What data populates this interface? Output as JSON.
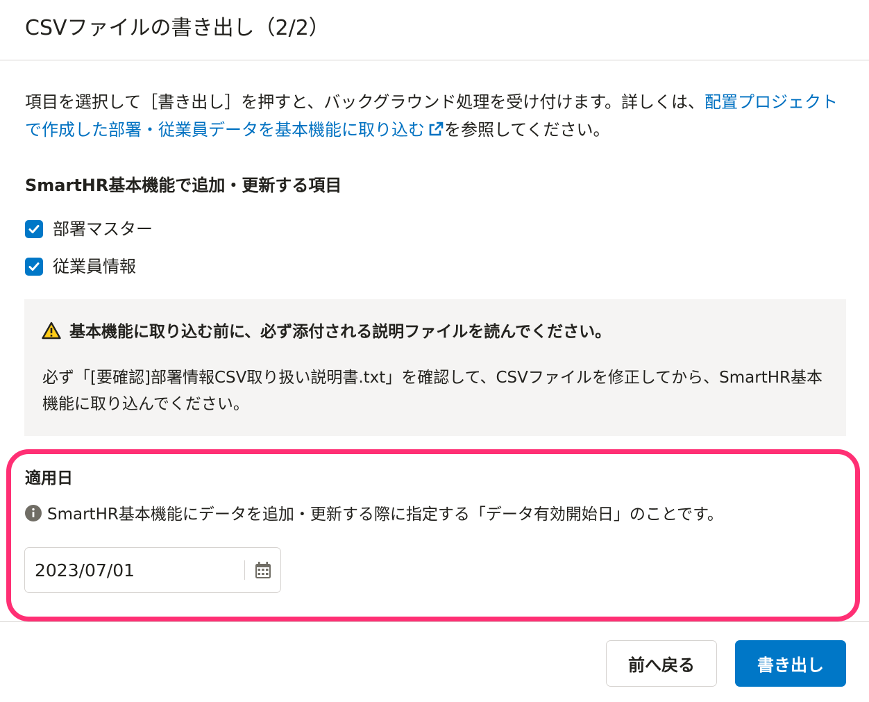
{
  "dialog": {
    "title": "CSVファイルの書き出し（2/2）"
  },
  "description": {
    "prefix": "項目を選択して［書き出し］を押すと、バックグラウンド処理を受け付けます。詳しくは、",
    "link_text": "配置プロジェクトで作成した部署・従業員データを基本機能に取り込む",
    "suffix": "を参照してください。"
  },
  "items_section": {
    "title": "SmartHR基本機能で追加・更新する項目",
    "checkboxes": [
      {
        "label": "部署マスター",
        "checked": true
      },
      {
        "label": "従業員情報",
        "checked": true
      }
    ]
  },
  "warning": {
    "title": "基本機能に取り込む前に、必ず添付される説明ファイルを読んでください。",
    "body": "必ず「[要確認]部署情報CSV取り扱い説明書.txt」を確認して、CSVファイルを修正してから、SmartHR基本機能に取り込んでください。"
  },
  "effective_date": {
    "label": "適用日",
    "info": "SmartHR基本機能にデータを追加・更新する際に指定する「データ有効開始日」のことです。",
    "value": "2023/07/01"
  },
  "footer": {
    "back_label": "前へ戻る",
    "export_label": "書き出し"
  },
  "colors": {
    "primary": "#0077c7",
    "link": "#0071c1",
    "highlight": "#ff2f74",
    "warning_bg": "#f5f4f3"
  },
  "icons": {
    "external_link": "external-link-icon",
    "warning": "warning-icon",
    "info": "info-icon",
    "calendar": "calendar-icon",
    "check": "check-icon"
  }
}
